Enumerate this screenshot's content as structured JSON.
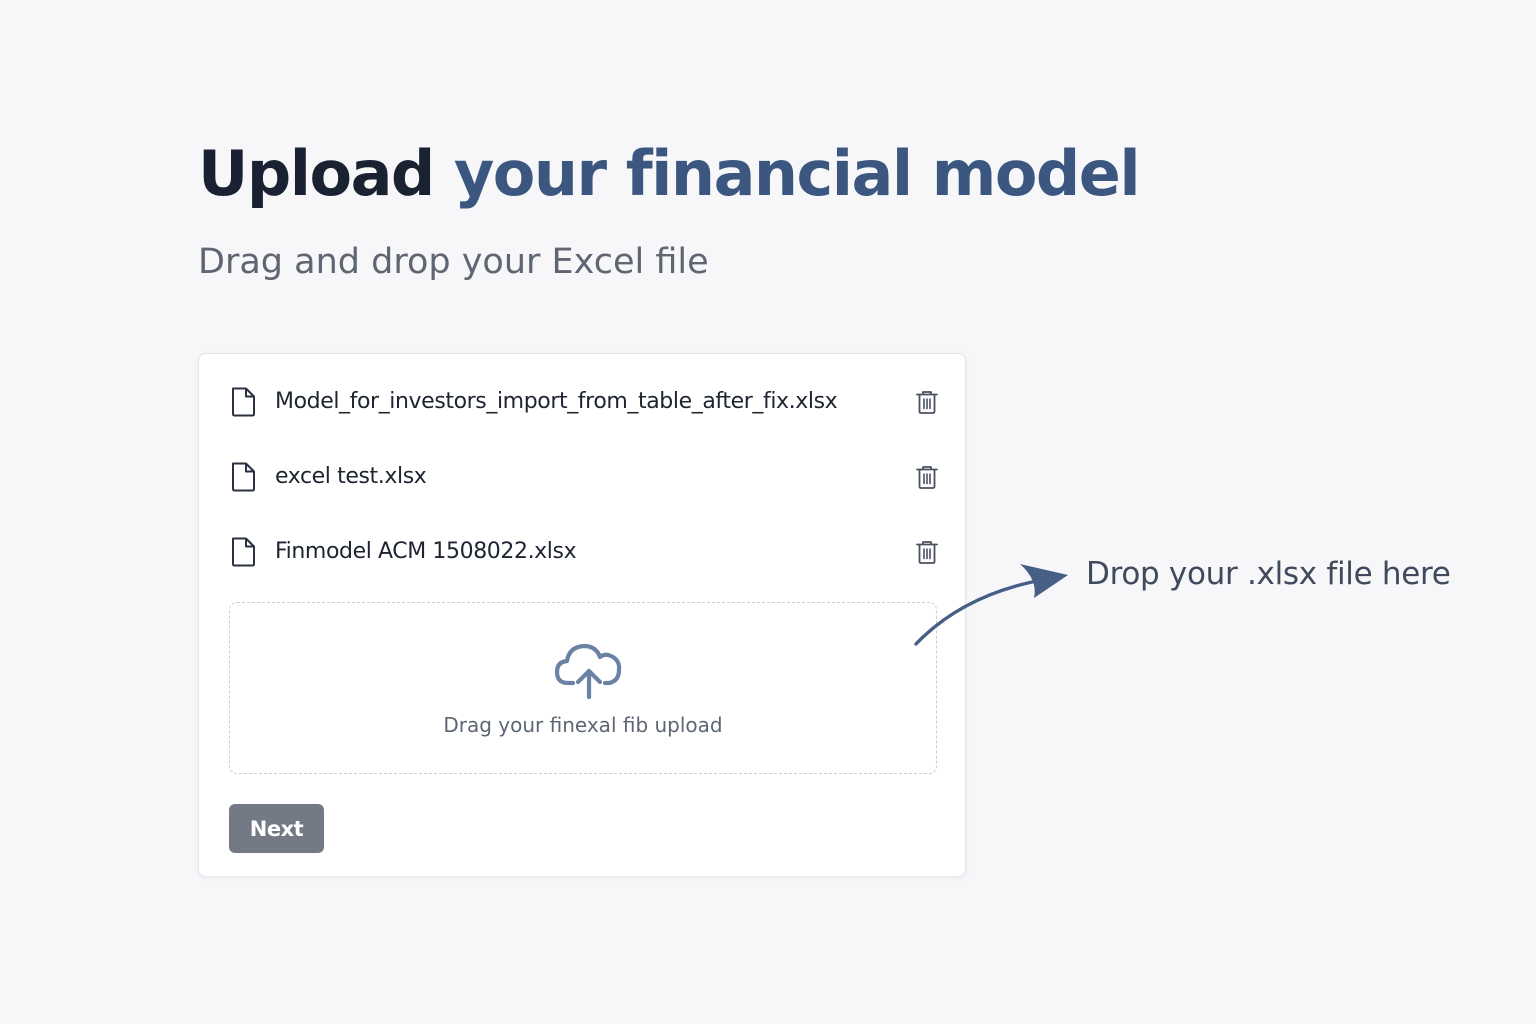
{
  "header": {
    "title_part1": "Upload",
    "title_part2": "your financial model",
    "subtitle": "Drag and drop your Excel file"
  },
  "files": [
    {
      "name": "Model_for_investors_import_from_table_after_fix.xlsx",
      "icon": "file-icon",
      "action_icon": "trash-icon"
    },
    {
      "name": "excel test.xlsx",
      "icon": "file-icon",
      "action_icon": "trash-icon"
    },
    {
      "name": "Finmodel ACM 1508022.xlsx",
      "icon": "file-icon",
      "action_icon": "trash-icon"
    }
  ],
  "dropzone": {
    "icon": "cloud-upload-icon",
    "text": "Drag your finexal fib upload"
  },
  "actions": {
    "next_label": "Next"
  },
  "annotation": {
    "text": "Drop your .xlsx file here",
    "icon": "curved-arrow-icon"
  },
  "colors": {
    "title_dark": "#1a2232",
    "title_accent": "#3b5780",
    "button_bg": "#737a86",
    "icon_blue": "#6a82a3",
    "arrow": "#465f85"
  }
}
